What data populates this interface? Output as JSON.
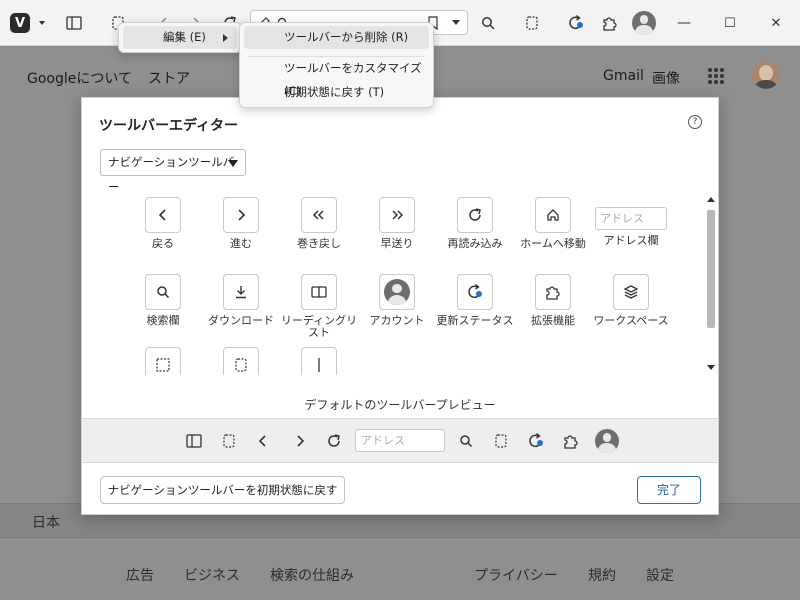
{
  "browser": {
    "window_controls": {
      "minimize": "—",
      "maximize": "☐",
      "close": "✕"
    }
  },
  "google": {
    "top_left_links": [
      "Googleについて",
      "ストア"
    ],
    "top_right_links": [
      "Gmail",
      "画像"
    ],
    "country": "日本",
    "footer_left": [
      "広告",
      "ビジネス",
      "検索の仕組み"
    ],
    "footer_right": [
      "プライバシー",
      "規約",
      "設定"
    ]
  },
  "context_menu": {
    "edit_label": "編集 (E)",
    "items": [
      {
        "label": "ツールバーから削除 (R)"
      },
      {
        "label": "ツールバーをカスタマイズ (C)"
      },
      {
        "label": "初期状態に戻す (T)"
      }
    ]
  },
  "editor": {
    "title": "ツールバーエディター",
    "help_label": "?",
    "toolbar_select": "ナビゲーションツールバー",
    "items": [
      {
        "label": "戻る",
        "icon": "back-icon"
      },
      {
        "label": "進む",
        "icon": "forward-icon"
      },
      {
        "label": "巻き戻し",
        "icon": "rewind-icon"
      },
      {
        "label": "早送り",
        "icon": "fast-forward-icon"
      },
      {
        "label": "再読み込み",
        "icon": "reload-icon"
      },
      {
        "label": "ホームへ移動",
        "icon": "home-icon"
      },
      {
        "label": "アドレス欄",
        "icon": "address-field",
        "placeholder": "アドレス"
      },
      {
        "label": "検索欄",
        "icon": "search-icon"
      },
      {
        "label": "ダウンロード",
        "icon": "download-icon"
      },
      {
        "label": "リーディングリスト",
        "icon": "reading-list-icon"
      },
      {
        "label": "アカウント",
        "icon": "account-icon"
      },
      {
        "label": "更新ステータス",
        "icon": "update-status-icon"
      },
      {
        "label": "拡張機能",
        "icon": "extensions-icon"
      },
      {
        "label": "ワークスペース",
        "icon": "workspaces-icon"
      }
    ],
    "preview_title": "デフォルトのツールバープレビュー",
    "preview_address_placeholder": "アドレス",
    "reset_button": "ナビゲーションツールバーを初期状態に戻す",
    "done_button": "完了"
  },
  "colors": {
    "accent": "#1e6fd9",
    "done_border": "#2b6fbf"
  }
}
